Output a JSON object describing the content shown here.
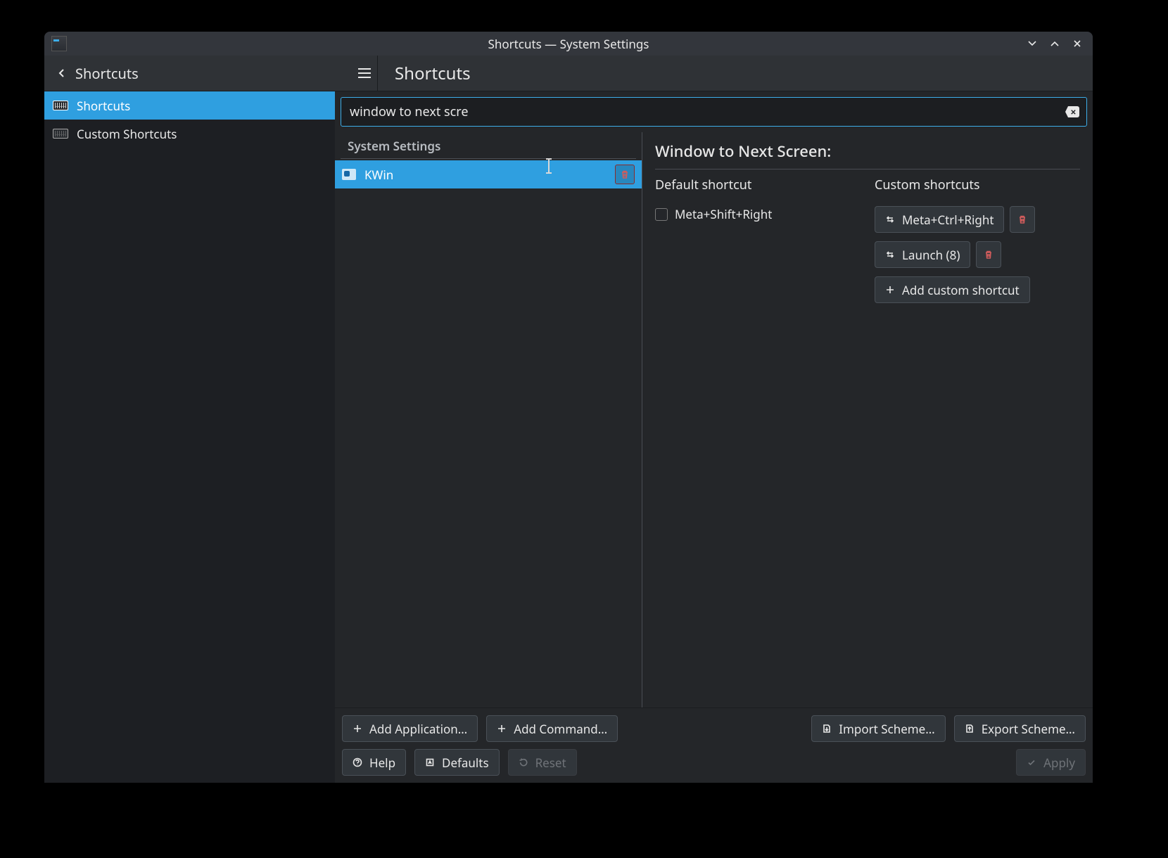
{
  "window": {
    "title": "Shortcuts — System Settings"
  },
  "header": {
    "breadcrumb": "Shortcuts",
    "page_title": "Shortcuts"
  },
  "sidebar": {
    "items": [
      {
        "label": "Shortcuts",
        "selected": true
      },
      {
        "label": "Custom Shortcuts",
        "selected": false
      }
    ]
  },
  "search": {
    "value": "window to next scre"
  },
  "categories": {
    "section_label": "System Settings",
    "items": [
      {
        "label": "KWin",
        "selected": true
      }
    ]
  },
  "detail": {
    "title": "Window to Next Screen:",
    "default_heading": "Default shortcut",
    "custom_heading": "Custom shortcuts",
    "default_shortcut": {
      "value": "Meta+Shift+Right",
      "checked": false
    },
    "custom_shortcuts": [
      {
        "value": "Meta+Ctrl+Right"
      },
      {
        "value": "Launch (8)"
      }
    ],
    "add_custom_label": "Add custom shortcut"
  },
  "footer": {
    "add_application": "Add Application…",
    "add_command": "Add Command…",
    "import_scheme": "Import Scheme…",
    "export_scheme": "Export Scheme…",
    "help": "Help",
    "defaults": "Defaults",
    "reset": "Reset",
    "apply": "Apply"
  }
}
